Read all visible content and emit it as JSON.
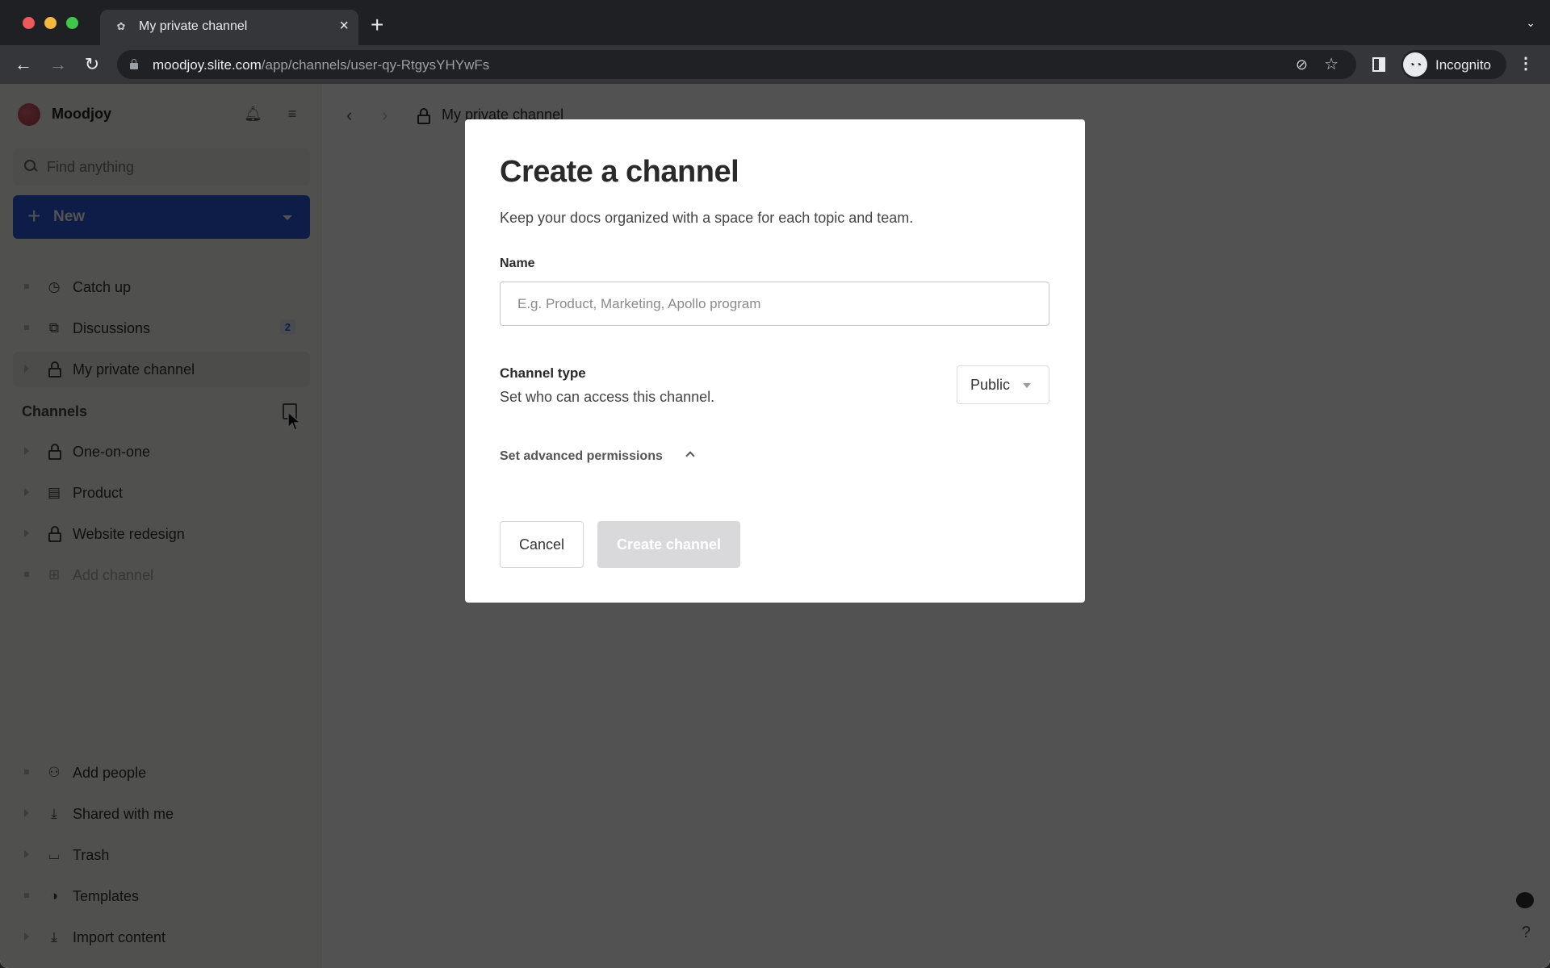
{
  "browser": {
    "tab_title": "My private channel",
    "tab_close": "×",
    "new_tab": "+",
    "tab_search": "⌄",
    "url_host": "moodjoy.slite.com",
    "url_path": "/app/channels/user-qy-RtgysYHYwFs",
    "profile_label": "Incognito",
    "back": "←",
    "forward": "→",
    "reload": "↻",
    "eye_off": "⊘",
    "star": "☆",
    "menu": "⋮",
    "incognito_glyph": "⌒"
  },
  "sidebar": {
    "workspace_name": "Moodjoy",
    "search_placeholder": "Find anything",
    "new_label": "New",
    "new_plus": "+",
    "top_items": [
      {
        "label": "Catch up",
        "icon": "🕓"
      },
      {
        "label": "Discussions",
        "icon": "💬",
        "badge": "2"
      },
      {
        "label": "My private channel",
        "icon": "lock"
      }
    ],
    "channels_title": "Channels",
    "channels": [
      {
        "label": "One-on-one",
        "icon": "lock"
      },
      {
        "label": "Product",
        "icon": "▤"
      },
      {
        "label": "Website redesign",
        "icon": "lock"
      },
      {
        "label": "Add channel",
        "icon": "⊞"
      }
    ],
    "bottom_items": [
      {
        "label": "Add people",
        "icon": "👤"
      },
      {
        "label": "Shared with me",
        "icon": "⤓"
      },
      {
        "label": "Trash",
        "icon": "🗑"
      },
      {
        "label": "Templates",
        "icon": "◑"
      },
      {
        "label": "Import content",
        "icon": "⤓"
      }
    ]
  },
  "main": {
    "breadcrumb_title": "My private channel",
    "back": "‹",
    "forward": "›",
    "help": "?"
  },
  "modal": {
    "title": "Create a channel",
    "description": "Keep your docs organized with a space for each topic and team.",
    "name_label": "Name",
    "name_value": "",
    "name_placeholder": "E.g. Product, Marketing, Apollo program",
    "channel_type_label": "Channel type",
    "channel_type_desc": "Set who can access this channel.",
    "channel_type_value": "Public",
    "advanced_label": "Set advanced permissions",
    "cancel_label": "Cancel",
    "create_label": "Create channel"
  },
  "colors": {
    "primary": "#2c5be0",
    "disabled_button": "#d9d9dc",
    "overlay": "rgba(0,0,0,0.68)"
  }
}
